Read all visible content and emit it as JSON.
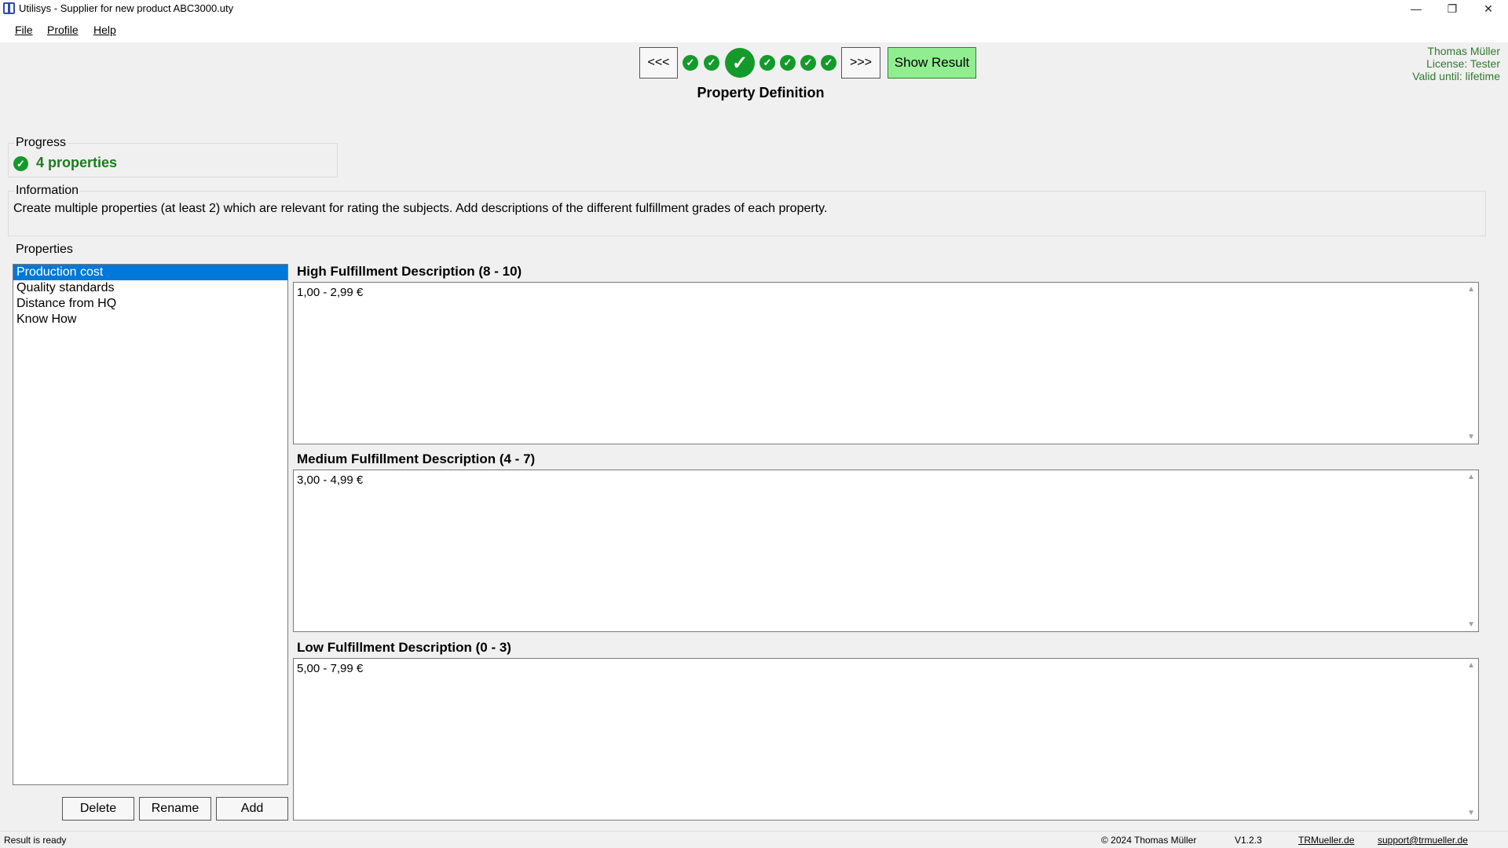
{
  "window": {
    "title": "Utilisys - Supplier for new product ABC3000.uty",
    "minimize": "—",
    "maximize": "❐",
    "close": "✕"
  },
  "menu": {
    "file": "File",
    "profile": "Profile",
    "help": "Help"
  },
  "nav": {
    "prev": "<<<",
    "next": ">>>",
    "show_result": "Show Result",
    "step_check": "✓",
    "current_step_index": 3,
    "total_steps": 8
  },
  "page_heading": "Property Definition",
  "user": {
    "name": "Thomas Müller",
    "license": "License: Tester",
    "valid": "Valid until: lifetime"
  },
  "progress": {
    "label": "Progress",
    "text": "4 properties",
    "icon": "✓"
  },
  "information": {
    "label": "Information",
    "text": "Create multiple properties (at least 2) which are relevant for rating the subjects. Add descriptions of the different fulfillment grades of each property."
  },
  "properties": {
    "label": "Properties",
    "items": [
      "Production cost",
      "Quality standards",
      "Distance from HQ",
      "Know How"
    ],
    "selected": 0,
    "delete": "Delete",
    "rename": "Rename",
    "add": "Add"
  },
  "descriptions": {
    "high_label": "High Fulfillment Description (8 - 10)",
    "high_value": "1,00 - 2,99 €",
    "medium_label": "Medium Fulfillment Description (4 - 7)",
    "medium_value": "3,00 - 4,99 €",
    "low_label": "Low Fulfillment Description (0 - 3)",
    "low_value": "5,00 - 7,99 €",
    "scroll_up": "▲",
    "scroll_down": "▼"
  },
  "status": {
    "message": "Result is ready",
    "copyright": "© 2024 Thomas Müller",
    "version": "V1.2.3",
    "website": "TRMueller.de",
    "email": "support@trmueller.de"
  },
  "colors": {
    "accent_green": "#139a2b",
    "show_result_bg": "#90ee90",
    "selection_blue": "#0078d7",
    "user_text": "#2f7a2f"
  }
}
